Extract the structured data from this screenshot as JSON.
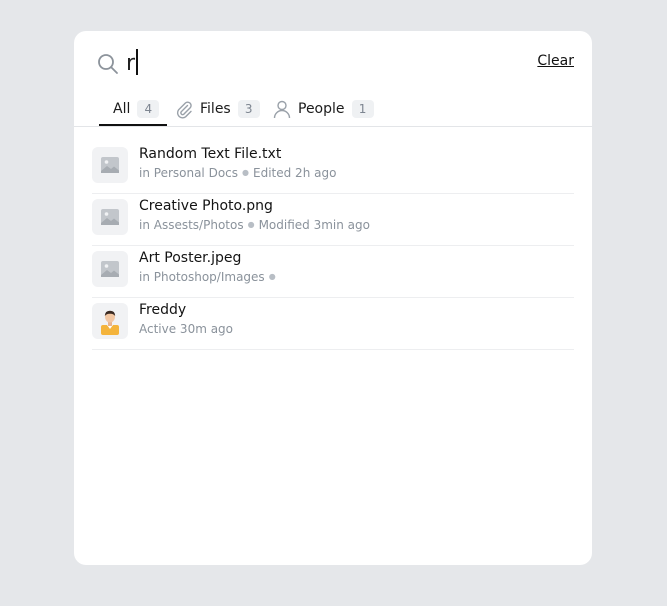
{
  "search": {
    "query": "r",
    "clear_label": "Clear"
  },
  "tabs": [
    {
      "label": "All",
      "count": "4",
      "icon": "none",
      "active": true
    },
    {
      "label": "Files",
      "count": "3",
      "icon": "paperclip-icon",
      "active": false
    },
    {
      "label": "People",
      "count": "1",
      "icon": "person-icon",
      "active": false
    }
  ],
  "results": [
    {
      "title": "Random Text File.txt",
      "location": "in Personal Docs",
      "meta": "Edited 2h ago",
      "icon": "image-placeholder-icon"
    },
    {
      "title": "Creative Photo.png",
      "location": "in Assests/Photos",
      "meta": "Modified 3min ago",
      "icon": "image-placeholder-icon"
    },
    {
      "title": "Art Poster.jpeg",
      "location": "in Photoshop/Images",
      "meta": "",
      "icon": "image-placeholder-icon"
    },
    {
      "title": "Freddy",
      "location": "Active 30m ago",
      "meta": "",
      "icon": "user-avatar-icon"
    }
  ],
  "colors": {
    "background": "#e5e7ea",
    "card": "#ffffff",
    "muted_text": "#8a929b",
    "avatar_shirt": "#f4b43c"
  }
}
